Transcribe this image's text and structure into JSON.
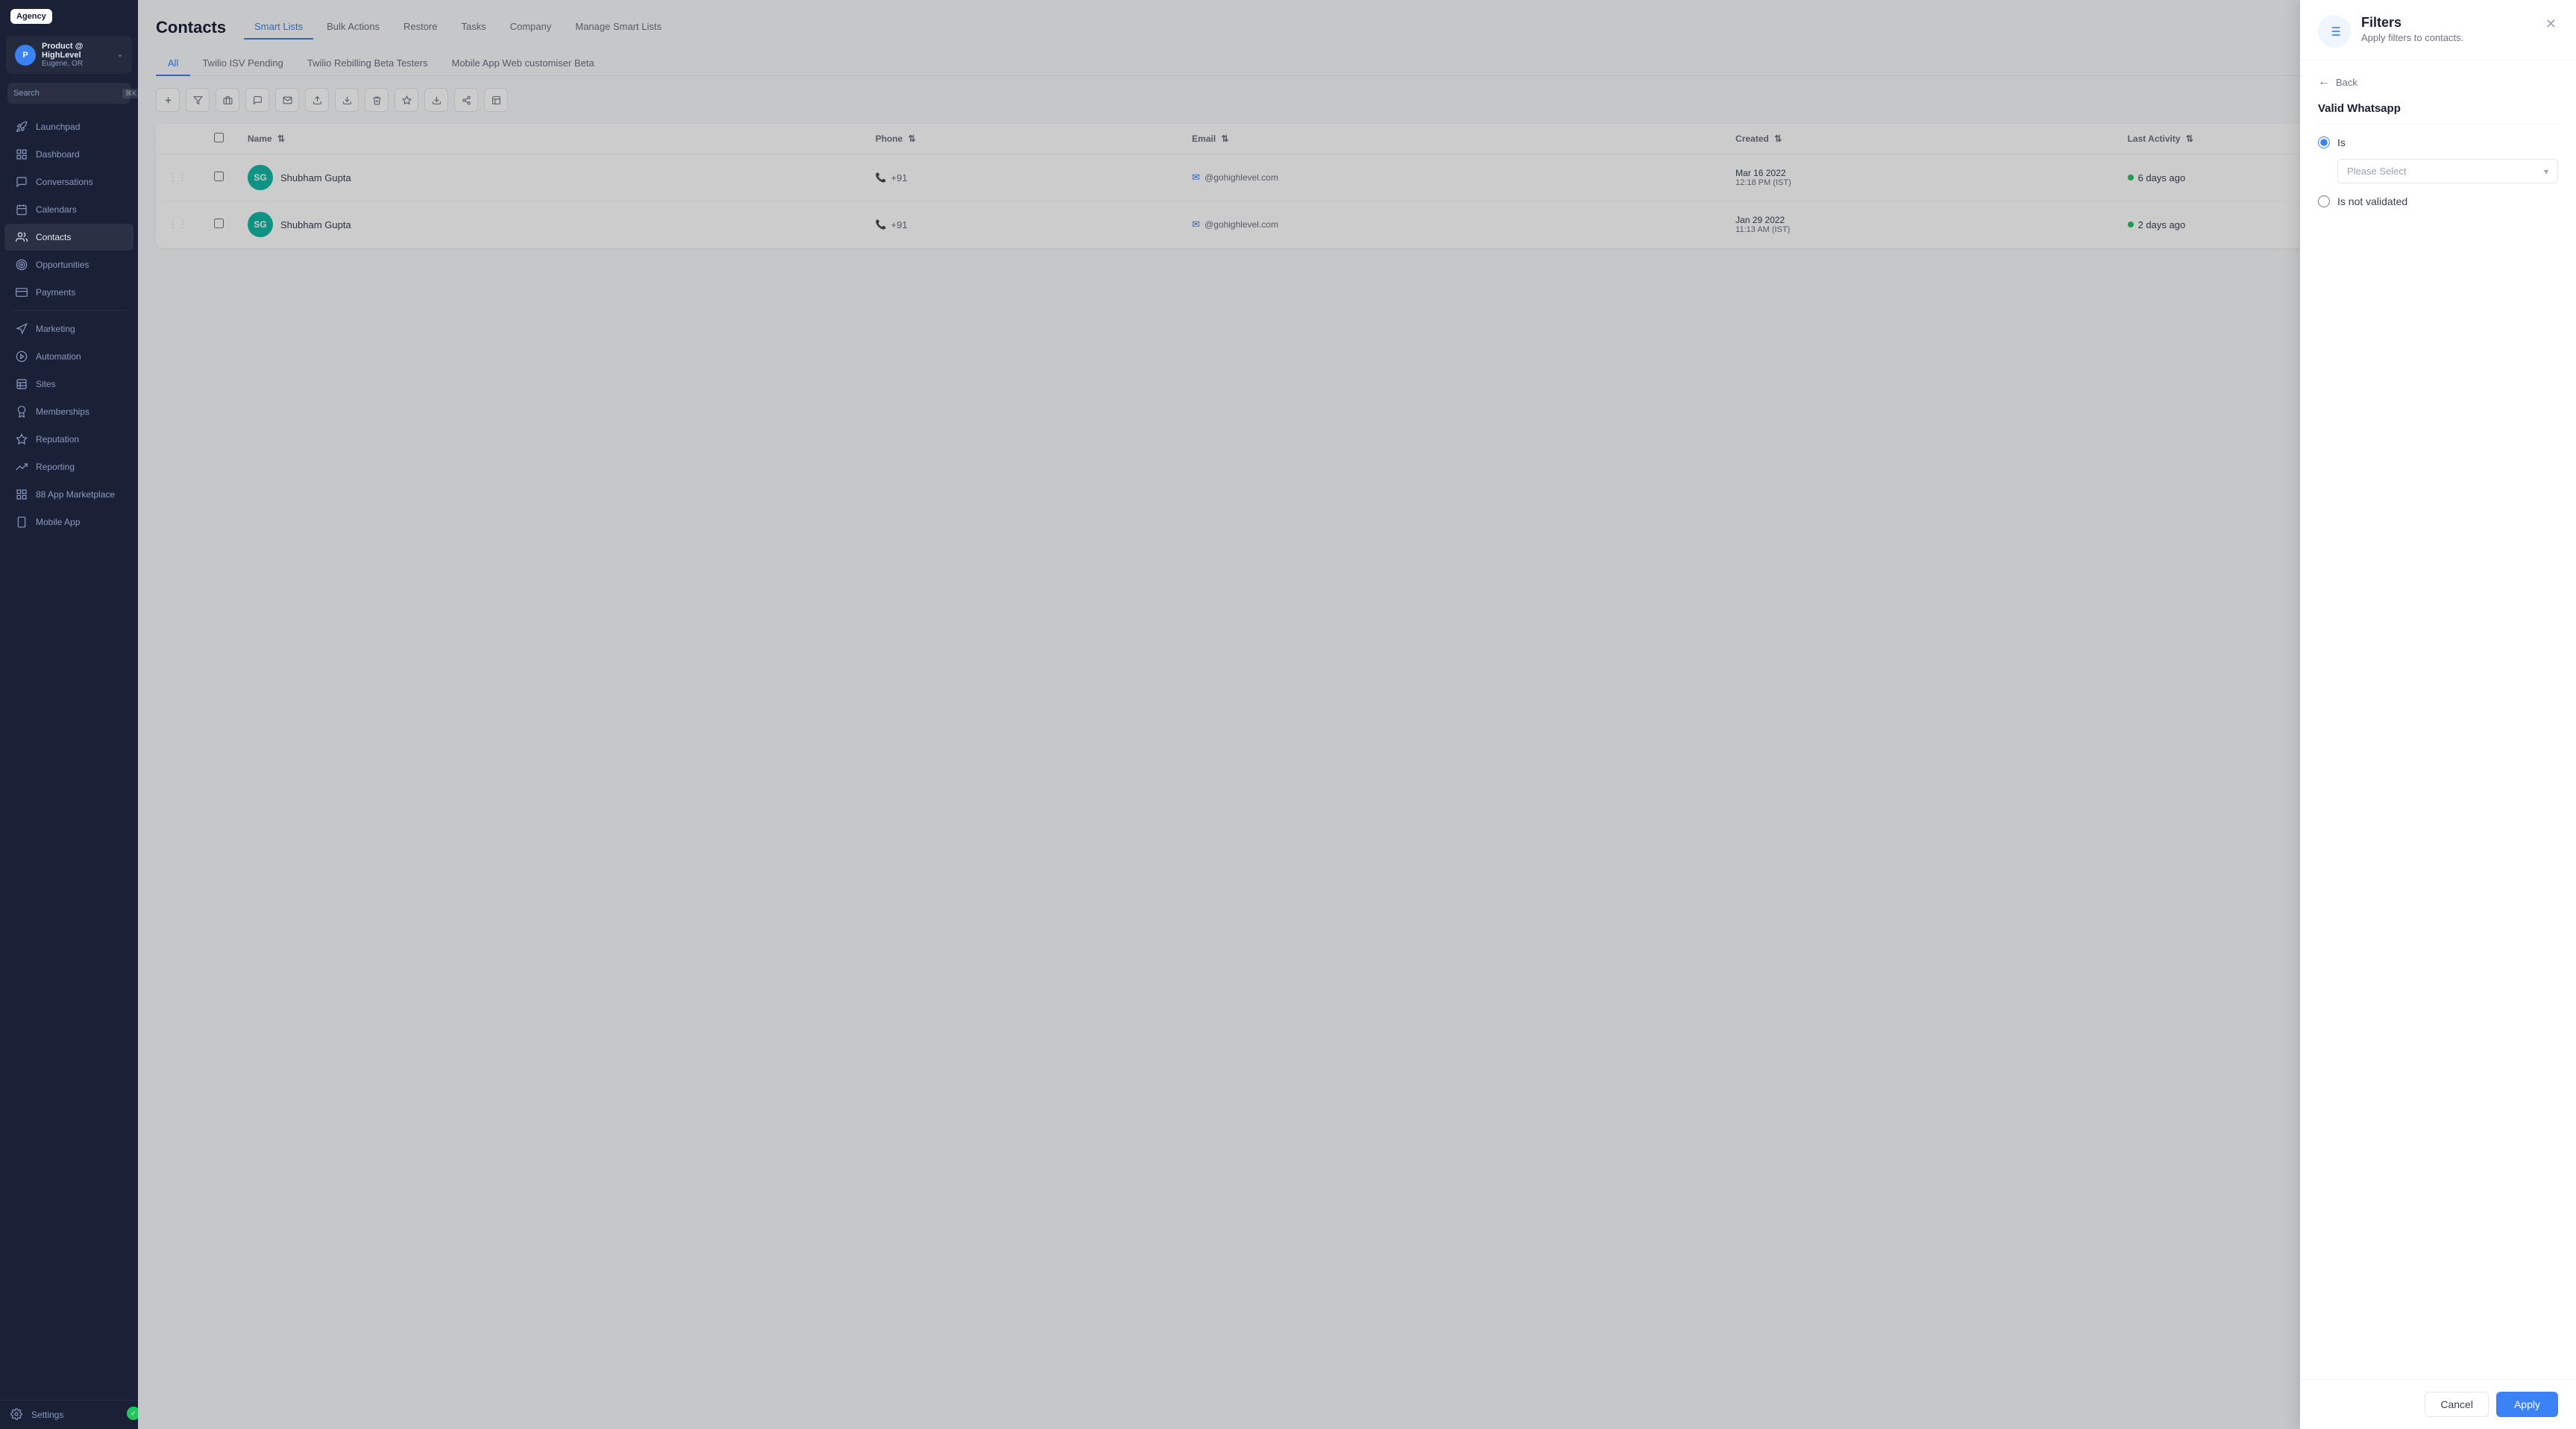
{
  "sidebar": {
    "logo": "Agency",
    "account": {
      "name": "Product @ HighLevel",
      "location": "Eugene, OR",
      "initials": "P"
    },
    "search_placeholder": "Search",
    "search_kbd": "⌘K",
    "nav_items": [
      {
        "id": "launchpad",
        "label": "Launchpad",
        "icon": "rocket"
      },
      {
        "id": "dashboard",
        "label": "Dashboard",
        "icon": "grid"
      },
      {
        "id": "conversations",
        "label": "Conversations",
        "icon": "chat"
      },
      {
        "id": "calendars",
        "label": "Calendars",
        "icon": "calendar"
      },
      {
        "id": "contacts",
        "label": "Contacts",
        "icon": "users",
        "active": true
      },
      {
        "id": "opportunities",
        "label": "Opportunities",
        "icon": "target"
      },
      {
        "id": "payments",
        "label": "Payments",
        "icon": "credit-card"
      },
      {
        "id": "marketing",
        "label": "Marketing",
        "icon": "megaphone"
      },
      {
        "id": "automation",
        "label": "Automation",
        "icon": "play-circle"
      },
      {
        "id": "sites",
        "label": "Sites",
        "icon": "table"
      },
      {
        "id": "memberships",
        "label": "Memberships",
        "icon": "award"
      },
      {
        "id": "reputation",
        "label": "Reputation",
        "icon": "star"
      },
      {
        "id": "reporting",
        "label": "Reporting",
        "icon": "trending-up"
      },
      {
        "id": "app-marketplace",
        "label": "App Marketplace",
        "icon": "grid-2"
      },
      {
        "id": "mobile-app",
        "label": "Mobile App",
        "icon": "smartphone"
      }
    ],
    "settings_label": "Settings"
  },
  "contacts_page": {
    "title": "Contacts",
    "header_tabs": [
      {
        "id": "smart-lists",
        "label": "Smart Lists",
        "active": true
      },
      {
        "id": "bulk-actions",
        "label": "Bulk Actions"
      },
      {
        "id": "restore",
        "label": "Restore"
      },
      {
        "id": "tasks",
        "label": "Tasks"
      },
      {
        "id": "company",
        "label": "Company"
      },
      {
        "id": "manage-smart-lists",
        "label": "Manage Smart Lists"
      }
    ],
    "sub_tabs": [
      {
        "id": "all",
        "label": "All",
        "active": true
      },
      {
        "id": "twilio-isv",
        "label": "Twilio ISV Pending"
      },
      {
        "id": "twilio-rebilling",
        "label": "Twilio Rebilling Beta Testers"
      },
      {
        "id": "mobile-app-web",
        "label": "Mobile App Web customiser Beta"
      }
    ],
    "toolbar": {
      "columns_btn": "Columns"
    },
    "table": {
      "columns": [
        "",
        "",
        "Name",
        "Phone",
        "Email",
        "Created",
        "Last Activity"
      ],
      "rows": [
        {
          "initials": "SG",
          "name": "Shubham Gupta",
          "phone": "+91",
          "email": "@gohighlevel.com",
          "created_date": "Mar 16 2022",
          "created_time": "12:18 PM (IST)",
          "last_activity": "6 days ago"
        },
        {
          "initials": "SG",
          "name": "Shubham Gupta",
          "phone": "+91",
          "email": "@gohighlevel.com",
          "created_date": "Jan 29 2022",
          "created_time": "11:13 AM (IST)",
          "last_activity": "2 days ago"
        }
      ]
    }
  },
  "filter_panel": {
    "title": "Filters",
    "subtitle": "Apply filters to contacts.",
    "back_label": "Back",
    "section_title": "Valid Whatsapp",
    "options": [
      {
        "id": "is",
        "label": "Is",
        "selected": true
      },
      {
        "id": "is-not-validated",
        "label": "Is not validated",
        "selected": false
      }
    ],
    "please_select_placeholder": "Please Select",
    "cancel_label": "Cancel",
    "apply_label": "Apply"
  }
}
